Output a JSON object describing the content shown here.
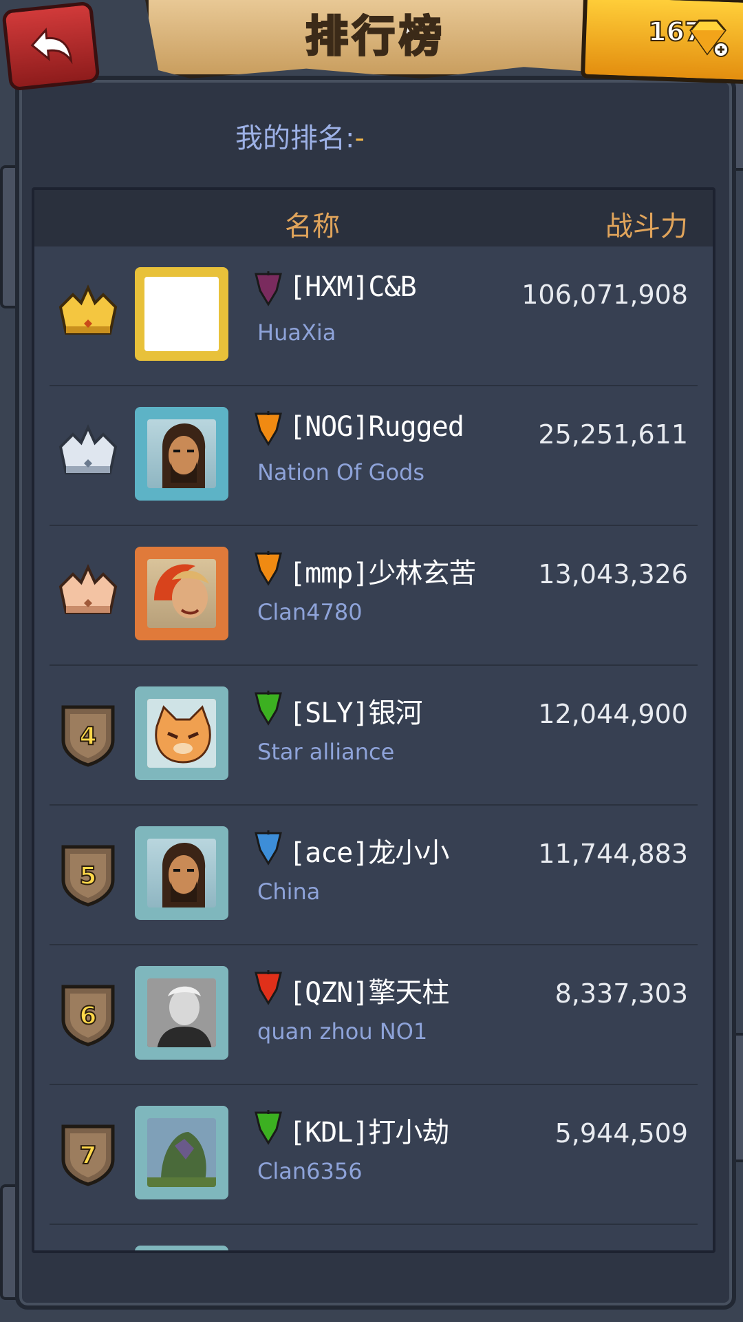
{
  "title": "排行榜",
  "gems": "167",
  "my_rank": {
    "label": "我的排名:",
    "value": "-"
  },
  "header": {
    "name": "名称",
    "power": "战斗力"
  },
  "rows": [
    {
      "rank": "1",
      "badge": "gold-crown",
      "name": "[HXM]C&B",
      "clan": "HuaXia",
      "power": "106,071,908",
      "flag_color": "#7a2b5e",
      "frame_color": "#e8c13a"
    },
    {
      "rank": "2",
      "badge": "silver-crown",
      "name": "[NOG]Rugged",
      "clan": "Nation Of Gods",
      "power": "25,251,611",
      "flag_color": "#f08a12",
      "frame_color": "#5db3c6"
    },
    {
      "rank": "3",
      "badge": "bronze-crown",
      "name": "[mmp]少林玄苦",
      "clan": "Clan4780",
      "power": "13,043,326",
      "flag_color": "#f08a12",
      "frame_color": "#e07a3a"
    },
    {
      "rank": "4",
      "badge": "shield",
      "name": "[SLY]银河",
      "clan": "Star alliance",
      "power": "12,044,900",
      "flag_color": "#3cb021",
      "frame_color": "#7fb7bd"
    },
    {
      "rank": "5",
      "badge": "shield",
      "name": "[ace]龙小小",
      "clan": "China",
      "power": "11,744,883",
      "flag_color": "#3d8ed8",
      "frame_color": "#7fb7bd"
    },
    {
      "rank": "6",
      "badge": "shield",
      "name": "[QZN]擎天柱",
      "clan": "quan zhou NO1",
      "power": "8,337,303",
      "flag_color": "#e0301a",
      "frame_color": "#7fb7bd"
    },
    {
      "rank": "7",
      "badge": "shield",
      "name": "[KDL]打小劫",
      "clan": "Clan6356",
      "power": "5,944,509",
      "flag_color": "#3cb021",
      "frame_color": "#7fb7bd"
    }
  ]
}
